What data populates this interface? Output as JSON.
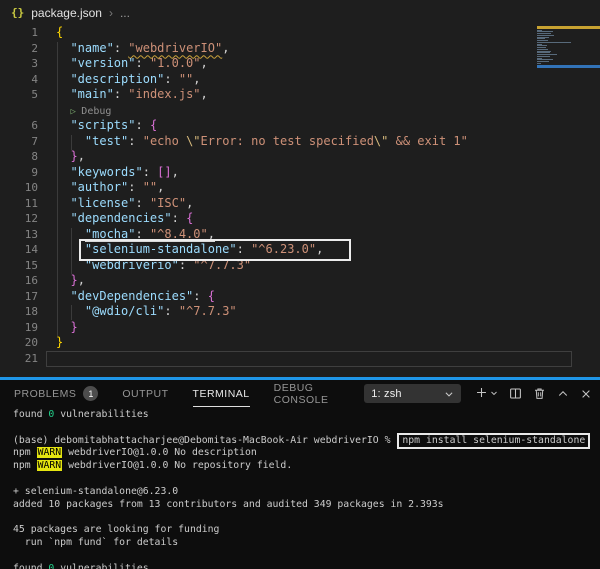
{
  "colors": {
    "editor_bg": "#1e1e1e",
    "panel_bg": "#0d0d0d",
    "panel_accent_border": "#1f96e8",
    "json_key": "#9cdcfe",
    "json_string": "#ce9178",
    "bracket_gold": "#ffd700",
    "bracket_purple": "#da70d6",
    "warn_badge_bg": "#e5e510",
    "terminal_green": "#23d18b",
    "annotation_box": "#ececec",
    "minimap_highlight_yellow": "#c8a231",
    "minimap_highlight_blue": "#3273b8"
  },
  "breadcrumb": {
    "file_icon": "{}",
    "file_name": "package.json",
    "separator": "›",
    "more": "..."
  },
  "editor": {
    "code_lines": [
      {
        "num": "1",
        "tokens": [
          [
            "{",
            "b1"
          ]
        ]
      },
      {
        "num": "2",
        "tokens": [
          [
            "  ",
            "pun"
          ],
          [
            "\"name\"",
            "key"
          ],
          [
            ": ",
            "pun"
          ],
          [
            "\"webdriverIO\"",
            "str warn"
          ],
          [
            ",",
            "pun"
          ]
        ]
      },
      {
        "num": "3",
        "tokens": [
          [
            "  ",
            "pun"
          ],
          [
            "\"version\"",
            "key"
          ],
          [
            ": ",
            "pun"
          ],
          [
            "\"1.0.0\"",
            "str"
          ],
          [
            ",",
            "pun"
          ]
        ]
      },
      {
        "num": "4",
        "tokens": [
          [
            "  ",
            "pun"
          ],
          [
            "\"description\"",
            "key"
          ],
          [
            ": ",
            "pun"
          ],
          [
            "\"\"",
            "str"
          ],
          [
            ",",
            "pun"
          ]
        ]
      },
      {
        "num": "5",
        "tokens": [
          [
            "  ",
            "pun"
          ],
          [
            "\"main\"",
            "key"
          ],
          [
            ": ",
            "pun"
          ],
          [
            "\"index.js\"",
            "str"
          ],
          [
            ",",
            "pun"
          ]
        ]
      },
      {
        "num": "",
        "lens": true,
        "tokens": [
          [
            "  ",
            "pun"
          ],
          [
            "▷ ",
            "lensicon"
          ],
          [
            "Debug",
            "lens"
          ]
        ]
      },
      {
        "num": "6",
        "tokens": [
          [
            "  ",
            "pun"
          ],
          [
            "\"scripts\"",
            "key"
          ],
          [
            ": ",
            "pun"
          ],
          [
            "{",
            "b2"
          ]
        ]
      },
      {
        "num": "7",
        "tokens": [
          [
            "    ",
            "pun"
          ],
          [
            "\"test\"",
            "key"
          ],
          [
            ": ",
            "pun"
          ],
          [
            "\"echo ",
            "str"
          ],
          [
            "\\\"",
            "esc"
          ],
          [
            "Error: no test specified",
            "str"
          ],
          [
            "\\\"",
            "esc"
          ],
          [
            " && exit 1\"",
            "str"
          ]
        ]
      },
      {
        "num": "8",
        "tokens": [
          [
            "  ",
            "pun"
          ],
          [
            "}",
            "b2"
          ],
          [
            ",",
            "pun"
          ]
        ]
      },
      {
        "num": "9",
        "tokens": [
          [
            "  ",
            "pun"
          ],
          [
            "\"keywords\"",
            "key"
          ],
          [
            ": ",
            "pun"
          ],
          [
            "[]",
            "b2"
          ],
          [
            ",",
            "pun"
          ]
        ]
      },
      {
        "num": "10",
        "tokens": [
          [
            "  ",
            "pun"
          ],
          [
            "\"author\"",
            "key"
          ],
          [
            ": ",
            "pun"
          ],
          [
            "\"\"",
            "str"
          ],
          [
            ",",
            "pun"
          ]
        ]
      },
      {
        "num": "11",
        "tokens": [
          [
            "  ",
            "pun"
          ],
          [
            "\"license\"",
            "key"
          ],
          [
            ": ",
            "pun"
          ],
          [
            "\"ISC\"",
            "str"
          ],
          [
            ",",
            "pun"
          ]
        ]
      },
      {
        "num": "12",
        "tokens": [
          [
            "  ",
            "pun"
          ],
          [
            "\"dependencies\"",
            "key"
          ],
          [
            ": ",
            "pun"
          ],
          [
            "{",
            "b2"
          ]
        ]
      },
      {
        "num": "13",
        "tokens": [
          [
            "    ",
            "pun"
          ],
          [
            "\"mocha\"",
            "key und"
          ],
          [
            ": ",
            "pun und"
          ],
          [
            "\"^8.4.0\"",
            "str und"
          ],
          [
            ",",
            "pun und"
          ]
        ]
      },
      {
        "num": "14",
        "tokens": [
          [
            "    ",
            "pun"
          ],
          [
            "\"selenium-standalone\"",
            "key"
          ],
          [
            ": ",
            "pun"
          ],
          [
            "\"^6.23.0\"",
            "str"
          ],
          [
            ",",
            "pun"
          ]
        ]
      },
      {
        "num": "15",
        "tokens": [
          [
            "    ",
            "pun"
          ],
          [
            "\"webdriverio\"",
            "key"
          ],
          [
            ": ",
            "pun"
          ],
          [
            "\"^7.7.3\"",
            "str"
          ]
        ]
      },
      {
        "num": "16",
        "tokens": [
          [
            "  ",
            "pun"
          ],
          [
            "}",
            "b2"
          ],
          [
            ",",
            "pun"
          ]
        ]
      },
      {
        "num": "17",
        "tokens": [
          [
            "  ",
            "pun"
          ],
          [
            "\"devDependencies\"",
            "key"
          ],
          [
            ": ",
            "pun"
          ],
          [
            "{",
            "b2"
          ]
        ]
      },
      {
        "num": "18",
        "tokens": [
          [
            "    ",
            "pun"
          ],
          [
            "\"@wdio/cli\"",
            "key"
          ],
          [
            ": ",
            "pun"
          ],
          [
            "\"^7.7.3\"",
            "str"
          ]
        ]
      },
      {
        "num": "19",
        "tokens": [
          [
            "  ",
            "pun"
          ],
          [
            "}",
            "b2"
          ]
        ]
      },
      {
        "num": "20",
        "tokens": [
          [
            "}",
            "b1"
          ]
        ]
      },
      {
        "num": "21",
        "tokens": []
      }
    ],
    "codelens_label": "Debug",
    "minimap_line_widths": [
      5,
      16,
      14,
      17,
      12,
      8,
      11,
      34,
      5,
      10,
      9,
      11,
      14,
      13,
      20,
      13,
      5,
      16,
      12,
      4
    ]
  },
  "panel": {
    "tabs": [
      {
        "label": "PROBLEMS",
        "badge": "1",
        "active": false
      },
      {
        "label": "OUTPUT",
        "active": false
      },
      {
        "label": "TERMINAL",
        "active": true
      },
      {
        "label": "DEBUG CONSOLE",
        "active": false
      }
    ],
    "shell_dropdown_value": "1: zsh",
    "icon_names": [
      "chevron-down-icon",
      "plus-icon",
      "chevron-down-small-icon",
      "split-terminal-icon",
      "trash-icon",
      "chevron-up-icon",
      "close-icon"
    ]
  },
  "terminal": {
    "rows": [
      [
        [
          "found ",
          "t"
        ],
        [
          "0",
          "g"
        ],
        [
          " vulnerabilities",
          "t"
        ]
      ],
      [],
      [
        [
          "(base) debomitabhattacharjee@Debomitas-MacBook-Air webdriverIO % ",
          "t"
        ],
        [
          "npm install selenium-standalone",
          "box"
        ]
      ],
      [
        [
          "npm ",
          "t"
        ],
        [
          "WARN",
          "wb"
        ],
        [
          " webdriverIO@1.0.0 No description",
          "t"
        ]
      ],
      [
        [
          "npm ",
          "t"
        ],
        [
          "WARN",
          "wb"
        ],
        [
          " webdriverIO@1.0.0 No repository field.",
          "t"
        ]
      ],
      [],
      [
        [
          "+ selenium-standalone@6.23.0",
          "t"
        ]
      ],
      [
        [
          "added 10 packages from 13 contributors and audited 349 packages in 2.393s",
          "t"
        ]
      ],
      [],
      [
        [
          "45 packages are looking for funding",
          "t"
        ]
      ],
      [
        [
          "  run `npm fund` for details",
          "t"
        ]
      ],
      [],
      [
        [
          "found ",
          "t"
        ],
        [
          "0",
          "g"
        ],
        [
          " vulnerabilities",
          "t"
        ]
      ]
    ]
  }
}
